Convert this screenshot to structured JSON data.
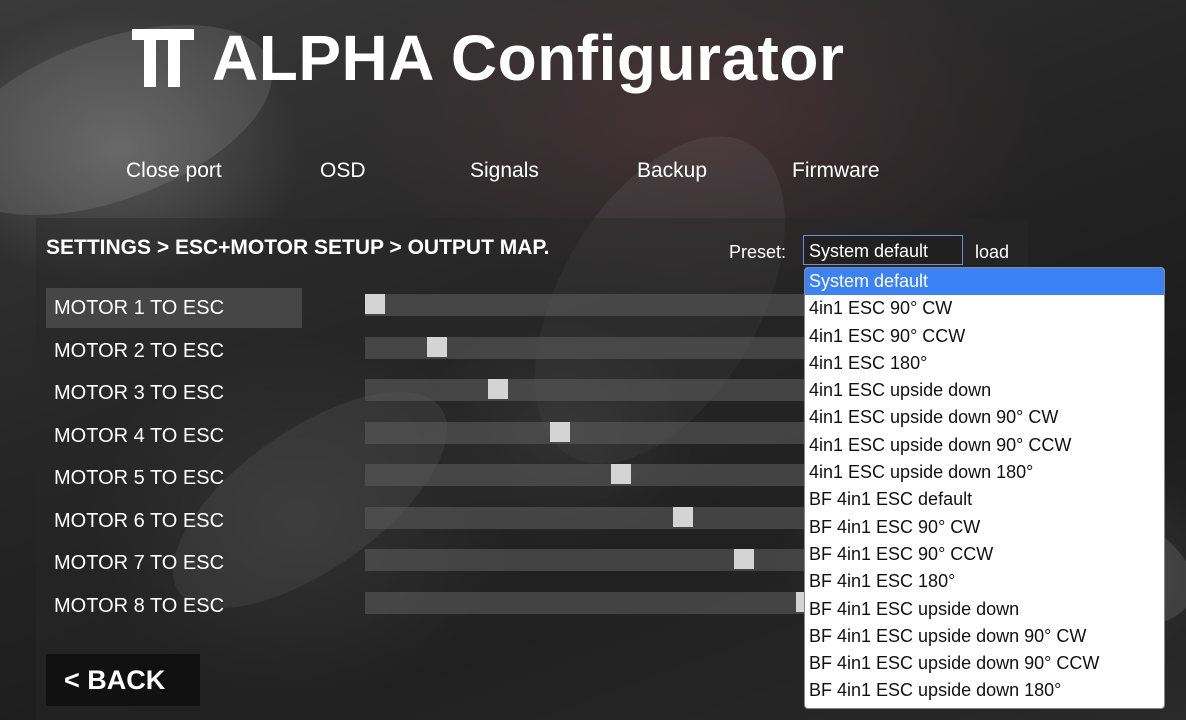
{
  "app": {
    "title": "ALPHA Configurator"
  },
  "nav": {
    "items": [
      "Close port",
      "OSD",
      "Signals",
      "Backup",
      "Firmware"
    ]
  },
  "breadcrumb": "SETTINGS > ESC+MOTOR SETUP > OUTPUT MAP.",
  "preset": {
    "label": "Preset:",
    "selected": "System default",
    "load_label": "load",
    "options": [
      "System default",
      "4in1 ESC 90° CW",
      "4in1 ESC 90° CCW",
      "4in1 ESC 180°",
      "4in1 ESC upside down",
      "4in1 ESC upside down 90° CW",
      "4in1 ESC upside down 90° CCW",
      "4in1 ESC upside down 180°",
      "BF 4in1 ESC default",
      "BF 4in1 ESC 90° CW",
      "BF 4in1 ESC 90° CCW",
      "BF 4in1 ESC 180°",
      "BF 4in1 ESC upside down",
      "BF 4in1 ESC upside down 90° CW",
      "BF 4in1 ESC upside down 90° CCW",
      "BF 4in1 ESC upside down 180°"
    ]
  },
  "motors": [
    {
      "label": "MOTOR 1 TO ESC",
      "esc": 1
    },
    {
      "label": "MOTOR 2 TO ESC",
      "esc": 2
    },
    {
      "label": "MOTOR 3 TO ESC",
      "esc": 3
    },
    {
      "label": "MOTOR 4 TO ESC",
      "esc": 4
    },
    {
      "label": "MOTOR 5 TO ESC",
      "esc": 5
    },
    {
      "label": "MOTOR 6 TO ESC",
      "esc": 6
    },
    {
      "label": "MOTOR 7 TO ESC",
      "esc": 7
    },
    {
      "label": "MOTOR 8 TO ESC",
      "esc": 8
    }
  ],
  "back_label": "< BACK",
  "colors": {
    "accent": "#3b82f6",
    "text": "#ffffff"
  }
}
